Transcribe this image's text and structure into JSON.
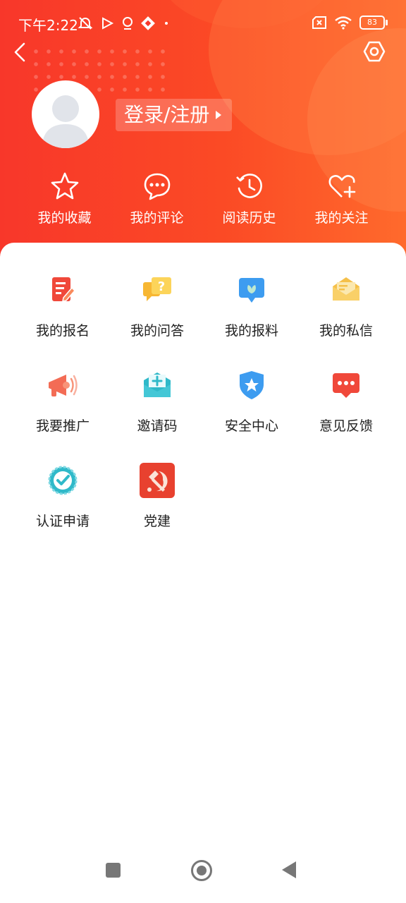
{
  "status_bar": {
    "time": "下午2:22",
    "battery": "83",
    "icons": [
      "mute-bell-icon",
      "play-icon",
      "location-icon",
      "app-icon",
      "dot-icon",
      "no-sim-icon",
      "wifi-icon",
      "battery-icon"
    ]
  },
  "header": {
    "login_label": "登录/注册"
  },
  "quick_actions": [
    {
      "label": "我的收藏",
      "icon": "star-icon"
    },
    {
      "label": "我的评论",
      "icon": "comment-icon"
    },
    {
      "label": "阅读历史",
      "icon": "history-icon"
    },
    {
      "label": "我的关注",
      "icon": "heart-plus-icon"
    }
  ],
  "grid_items": [
    {
      "label": "我的报名",
      "icon": "signup-icon"
    },
    {
      "label": "我的问答",
      "icon": "qa-icon"
    },
    {
      "label": "我的报料",
      "icon": "report-icon"
    },
    {
      "label": "我的私信",
      "icon": "message-icon"
    },
    {
      "label": "我要推广",
      "icon": "megaphone-icon"
    },
    {
      "label": "邀请码",
      "icon": "invite-code-icon"
    },
    {
      "label": "安全中心",
      "icon": "shield-icon"
    },
    {
      "label": "意见反馈",
      "icon": "feedback-icon"
    },
    {
      "label": "认证申请",
      "icon": "verify-icon"
    },
    {
      "label": "党建",
      "icon": "party-icon"
    }
  ],
  "colors": {
    "header_start": "#f8372a",
    "header_end": "#ff6a2c",
    "text_dark": "#222222"
  }
}
